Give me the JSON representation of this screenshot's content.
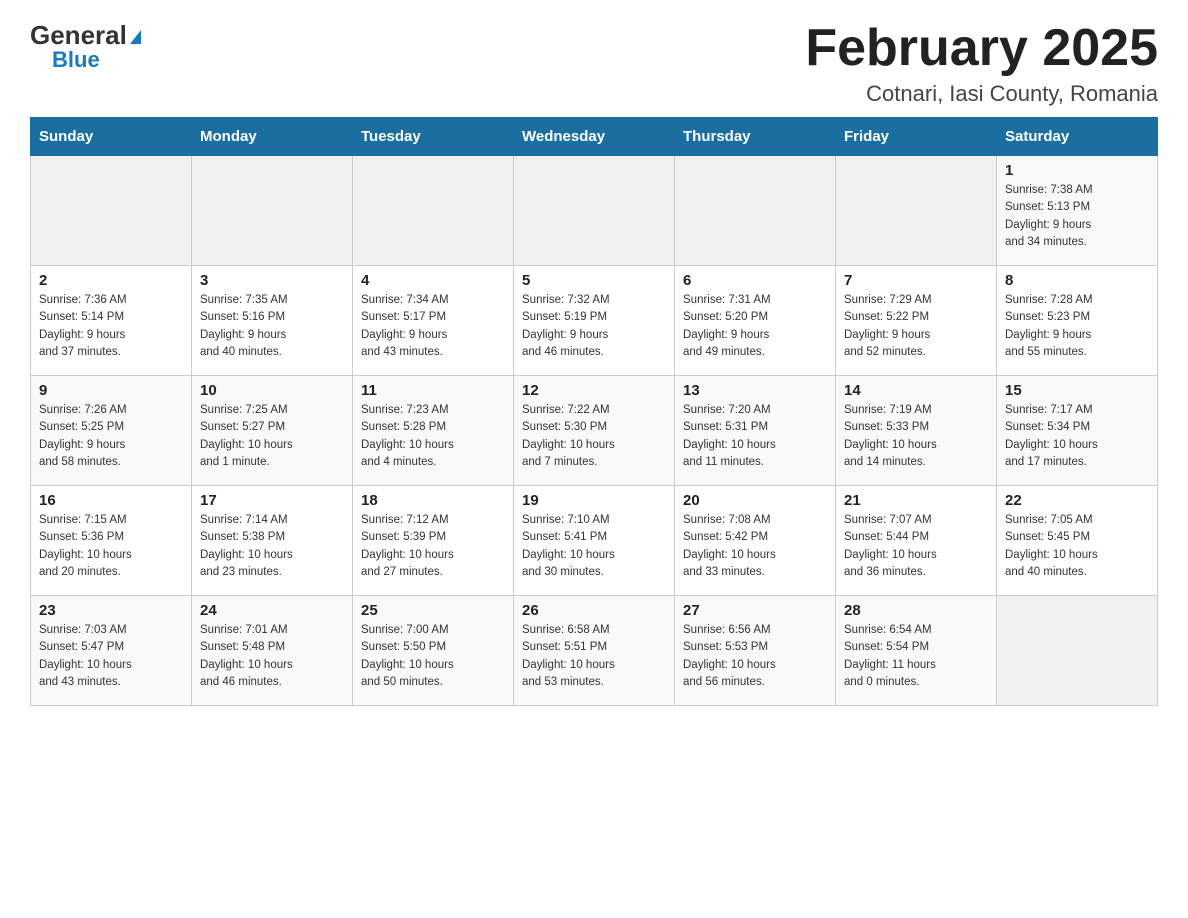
{
  "header": {
    "logo_general": "General",
    "logo_blue": "Blue",
    "month_year": "February 2025",
    "location": "Cotnari, Iasi County, Romania"
  },
  "weekdays": [
    "Sunday",
    "Monday",
    "Tuesday",
    "Wednesday",
    "Thursday",
    "Friday",
    "Saturday"
  ],
  "weeks": [
    [
      {
        "day": "",
        "info": ""
      },
      {
        "day": "",
        "info": ""
      },
      {
        "day": "",
        "info": ""
      },
      {
        "day": "",
        "info": ""
      },
      {
        "day": "",
        "info": ""
      },
      {
        "day": "",
        "info": ""
      },
      {
        "day": "1",
        "info": "Sunrise: 7:38 AM\nSunset: 5:13 PM\nDaylight: 9 hours\nand 34 minutes."
      }
    ],
    [
      {
        "day": "2",
        "info": "Sunrise: 7:36 AM\nSunset: 5:14 PM\nDaylight: 9 hours\nand 37 minutes."
      },
      {
        "day": "3",
        "info": "Sunrise: 7:35 AM\nSunset: 5:16 PM\nDaylight: 9 hours\nand 40 minutes."
      },
      {
        "day": "4",
        "info": "Sunrise: 7:34 AM\nSunset: 5:17 PM\nDaylight: 9 hours\nand 43 minutes."
      },
      {
        "day": "5",
        "info": "Sunrise: 7:32 AM\nSunset: 5:19 PM\nDaylight: 9 hours\nand 46 minutes."
      },
      {
        "day": "6",
        "info": "Sunrise: 7:31 AM\nSunset: 5:20 PM\nDaylight: 9 hours\nand 49 minutes."
      },
      {
        "day": "7",
        "info": "Sunrise: 7:29 AM\nSunset: 5:22 PM\nDaylight: 9 hours\nand 52 minutes."
      },
      {
        "day": "8",
        "info": "Sunrise: 7:28 AM\nSunset: 5:23 PM\nDaylight: 9 hours\nand 55 minutes."
      }
    ],
    [
      {
        "day": "9",
        "info": "Sunrise: 7:26 AM\nSunset: 5:25 PM\nDaylight: 9 hours\nand 58 minutes."
      },
      {
        "day": "10",
        "info": "Sunrise: 7:25 AM\nSunset: 5:27 PM\nDaylight: 10 hours\nand 1 minute."
      },
      {
        "day": "11",
        "info": "Sunrise: 7:23 AM\nSunset: 5:28 PM\nDaylight: 10 hours\nand 4 minutes."
      },
      {
        "day": "12",
        "info": "Sunrise: 7:22 AM\nSunset: 5:30 PM\nDaylight: 10 hours\nand 7 minutes."
      },
      {
        "day": "13",
        "info": "Sunrise: 7:20 AM\nSunset: 5:31 PM\nDaylight: 10 hours\nand 11 minutes."
      },
      {
        "day": "14",
        "info": "Sunrise: 7:19 AM\nSunset: 5:33 PM\nDaylight: 10 hours\nand 14 minutes."
      },
      {
        "day": "15",
        "info": "Sunrise: 7:17 AM\nSunset: 5:34 PM\nDaylight: 10 hours\nand 17 minutes."
      }
    ],
    [
      {
        "day": "16",
        "info": "Sunrise: 7:15 AM\nSunset: 5:36 PM\nDaylight: 10 hours\nand 20 minutes."
      },
      {
        "day": "17",
        "info": "Sunrise: 7:14 AM\nSunset: 5:38 PM\nDaylight: 10 hours\nand 23 minutes."
      },
      {
        "day": "18",
        "info": "Sunrise: 7:12 AM\nSunset: 5:39 PM\nDaylight: 10 hours\nand 27 minutes."
      },
      {
        "day": "19",
        "info": "Sunrise: 7:10 AM\nSunset: 5:41 PM\nDaylight: 10 hours\nand 30 minutes."
      },
      {
        "day": "20",
        "info": "Sunrise: 7:08 AM\nSunset: 5:42 PM\nDaylight: 10 hours\nand 33 minutes."
      },
      {
        "day": "21",
        "info": "Sunrise: 7:07 AM\nSunset: 5:44 PM\nDaylight: 10 hours\nand 36 minutes."
      },
      {
        "day": "22",
        "info": "Sunrise: 7:05 AM\nSunset: 5:45 PM\nDaylight: 10 hours\nand 40 minutes."
      }
    ],
    [
      {
        "day": "23",
        "info": "Sunrise: 7:03 AM\nSunset: 5:47 PM\nDaylight: 10 hours\nand 43 minutes."
      },
      {
        "day": "24",
        "info": "Sunrise: 7:01 AM\nSunset: 5:48 PM\nDaylight: 10 hours\nand 46 minutes."
      },
      {
        "day": "25",
        "info": "Sunrise: 7:00 AM\nSunset: 5:50 PM\nDaylight: 10 hours\nand 50 minutes."
      },
      {
        "day": "26",
        "info": "Sunrise: 6:58 AM\nSunset: 5:51 PM\nDaylight: 10 hours\nand 53 minutes."
      },
      {
        "day": "27",
        "info": "Sunrise: 6:56 AM\nSunset: 5:53 PM\nDaylight: 10 hours\nand 56 minutes."
      },
      {
        "day": "28",
        "info": "Sunrise: 6:54 AM\nSunset: 5:54 PM\nDaylight: 11 hours\nand 0 minutes."
      },
      {
        "day": "",
        "info": ""
      }
    ]
  ]
}
